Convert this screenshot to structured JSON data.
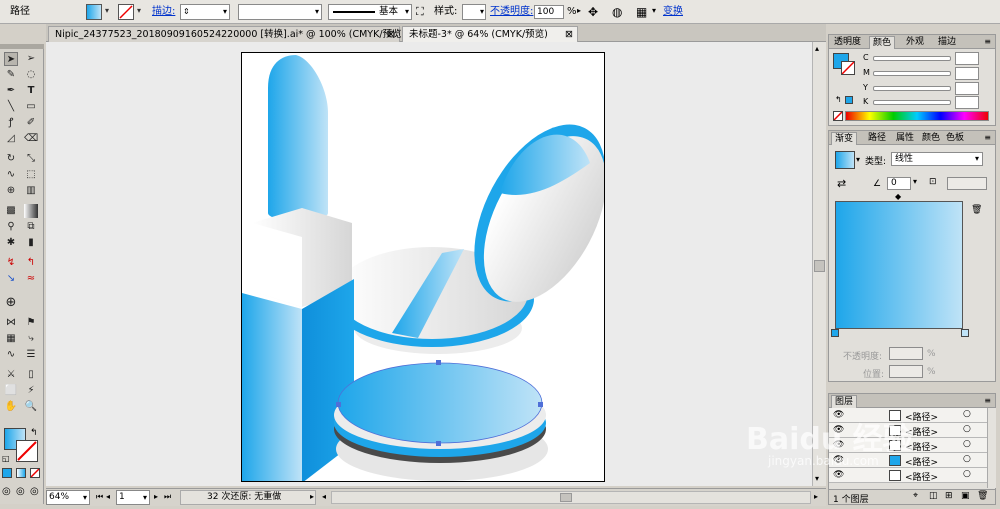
{
  "control_bar": {
    "selection_label": "路径",
    "stroke_label": "描边:",
    "brush_label": "基本",
    "style_label": "样式:",
    "opacity_label": "不透明度:",
    "opacity_value": "100",
    "opacity_unit": "%",
    "transform_label": "变换"
  },
  "tabs": [
    {
      "label": "Nipic_24377523_20180909160524220000 [转换].ai* @ 100% (CMYK/预览)"
    },
    {
      "label": "未标题-3* @ 64% (CMYK/预览)"
    }
  ],
  "status": {
    "zoom": "64%",
    "page": "1",
    "undo_text": "32 次还原: 无重做"
  },
  "transparency_panel": {
    "tabs": [
      "透明度",
      "颜色",
      "外观",
      "描边"
    ],
    "active_tab": "颜色",
    "channels": [
      "C",
      "M",
      "Y",
      "K"
    ]
  },
  "gradient_panel": {
    "tabs": [
      "渐变",
      "路径",
      "属性",
      "颜色",
      "色板"
    ],
    "active_tab": "渐变",
    "type_label": "类型:",
    "type_value": "线性",
    "angle_value": "0",
    "opacity_label": "不透明度:",
    "position_label": "位置:",
    "unit": "%"
  },
  "layers_panel": {
    "title": "图层",
    "rows": [
      "<路径>",
      "<路径>",
      "<路径>",
      "<路径>",
      "<路径>"
    ],
    "footer": "1 个图层"
  },
  "watermark": {
    "text": "Baidu 经验",
    "url": "jingyan.baidu.com"
  },
  "colors": {
    "accent_blue": "#1ea6ea",
    "light_blue": "#bfe3f7",
    "gray": "#dcdcdc",
    "dark_gray": "#6d6d6d",
    "link_blue": "#0033cc"
  }
}
